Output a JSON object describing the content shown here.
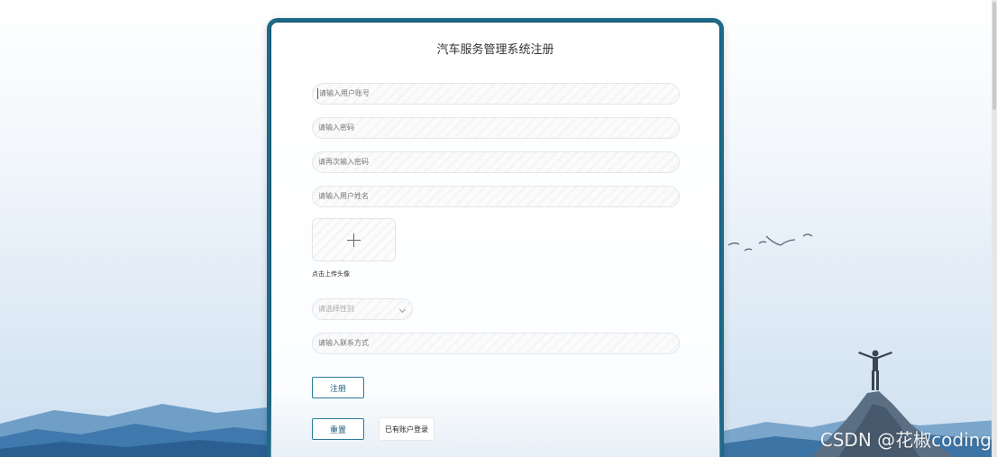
{
  "page": {
    "title": "汽车服务管理系统注册",
    "watermark": "CSDN @花椒coding"
  },
  "form": {
    "username_placeholder": "请输入用户账号",
    "password_placeholder": "请输入密码",
    "confirm_password_placeholder": "请再次输入密码",
    "name_placeholder": "请输入用户姓名",
    "upload_label": "点击上传头像",
    "gender_placeholder": "请选择性别",
    "contact_placeholder": "请输入联系方式"
  },
  "buttons": {
    "register": "注册",
    "reset": "重置",
    "have_account_login": "已有账户登录"
  },
  "colors": {
    "accent_border": "#1d6a8a",
    "button_text": "#1d5f7a"
  }
}
